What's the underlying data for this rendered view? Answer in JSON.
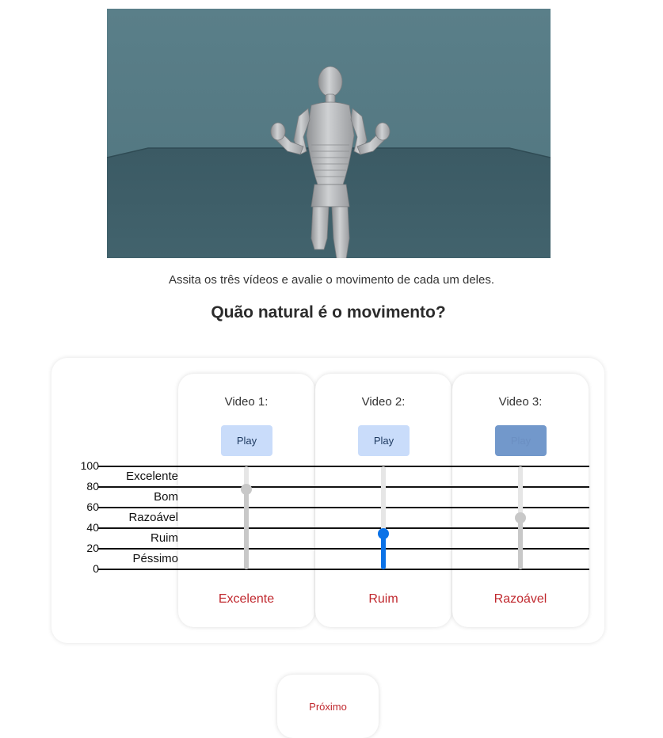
{
  "instruction": "Assita os três vídeos e avalie o movimento de cada um deles.",
  "question": "Quão natural é o movimento?",
  "scale": {
    "ticks": [
      "100",
      "80",
      "60",
      "40",
      "20",
      "0"
    ],
    "categories": [
      "Excelente",
      "Bom",
      "Razoável",
      "Ruim",
      "Péssimo"
    ]
  },
  "videos": [
    {
      "title": "Video 1:",
      "play_label": "Play",
      "rating_value": 78,
      "rating_label": "Excelente",
      "active": false
    },
    {
      "title": "Video 2:",
      "play_label": "Play",
      "rating_value": 35,
      "rating_label": "Ruim",
      "active": true
    },
    {
      "title": "Video 3:",
      "play_label": "Play",
      "rating_value": 50,
      "rating_label": "Razoável",
      "active": false
    }
  ],
  "next_label": "Próximo",
  "colors": {
    "accent": "#0b72e7",
    "rating_text": "#c0282e",
    "play_button": "#c9dcfa",
    "play_button_disabled": "#7298cb",
    "scene_background": "#577d87",
    "scene_floor": "#3d5c66"
  }
}
